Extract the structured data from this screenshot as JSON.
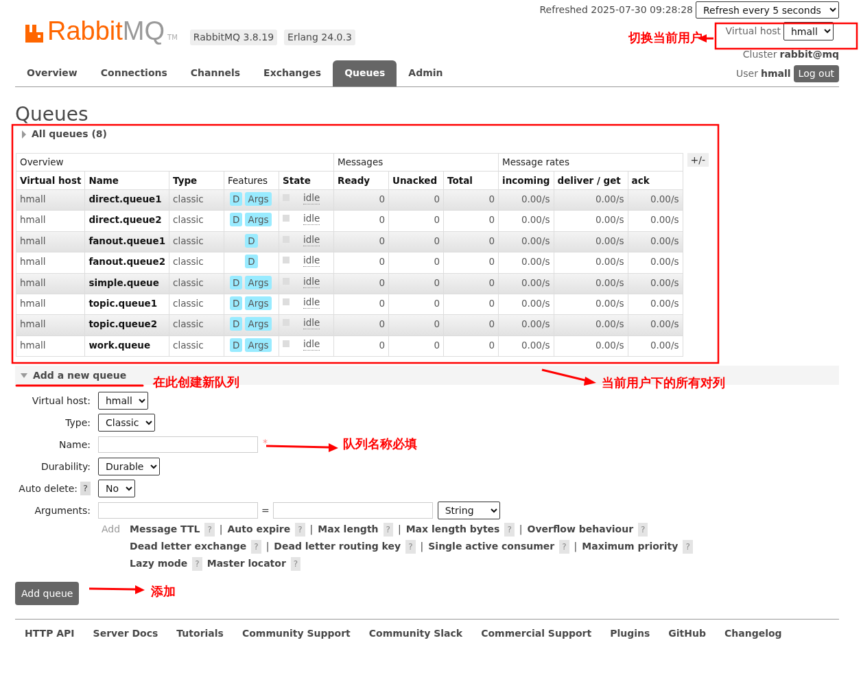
{
  "header": {
    "logo": {
      "primary": "Rabbit",
      "secondary": "MQ",
      "tm": "TM"
    },
    "versions": [
      "RabbitMQ 3.8.19",
      "Erlang 24.0.3"
    ],
    "refreshed": "Refreshed 2025-07-30 09:28:28",
    "refresh_select": "Refresh every 5 seconds",
    "virtual_host_label": "Virtual host",
    "virtual_host_select": "hmall",
    "cluster_label": "Cluster",
    "cluster_value": "rabbit@mq",
    "user_label": "User",
    "user_value": "hmall",
    "logout_button": "Log out"
  },
  "tabs": [
    {
      "label": "Overview",
      "selected": false
    },
    {
      "label": "Connections",
      "selected": false
    },
    {
      "label": "Channels",
      "selected": false
    },
    {
      "label": "Exchanges",
      "selected": false
    },
    {
      "label": "Queues",
      "selected": true
    },
    {
      "label": "Admin",
      "selected": false
    }
  ],
  "page_title": "Queues",
  "all_queues": {
    "title": "All queues (8)",
    "expanded": false,
    "columns_toggle": "+/-",
    "groups": [
      {
        "label": "Overview",
        "columns": [
          {
            "label": "Virtual host",
            "bold": true
          },
          {
            "label": "Name",
            "bold": true
          },
          {
            "label": "Type",
            "bold": true
          },
          {
            "label": "Features",
            "bold": false
          },
          {
            "label": "State",
            "bold": true
          }
        ]
      },
      {
        "label": "Messages",
        "columns": [
          {
            "label": "Ready",
            "bold": true
          },
          {
            "label": "Unacked",
            "bold": true
          },
          {
            "label": "Total",
            "bold": true
          }
        ]
      },
      {
        "label": "Message rates",
        "columns": [
          {
            "label": "incoming",
            "bold": true
          },
          {
            "label": "deliver / get",
            "bold": true
          },
          {
            "label": "ack",
            "bold": true
          }
        ]
      }
    ],
    "rows": [
      {
        "vhost": "hmall",
        "name": "direct.queue1",
        "type": "classic",
        "features": [
          "D",
          "Args"
        ],
        "state": "idle",
        "ready": "0",
        "unacked": "0",
        "total": "0",
        "incoming": "0.00/s",
        "deliver_get": "0.00/s",
        "ack": "0.00/s"
      },
      {
        "vhost": "hmall",
        "name": "direct.queue2",
        "type": "classic",
        "features": [
          "D",
          "Args"
        ],
        "state": "idle",
        "ready": "0",
        "unacked": "0",
        "total": "0",
        "incoming": "0.00/s",
        "deliver_get": "0.00/s",
        "ack": "0.00/s"
      },
      {
        "vhost": "hmall",
        "name": "fanout.queue1",
        "type": "classic",
        "features": [
          "D"
        ],
        "state": "idle",
        "ready": "0",
        "unacked": "0",
        "total": "0",
        "incoming": "0.00/s",
        "deliver_get": "0.00/s",
        "ack": "0.00/s"
      },
      {
        "vhost": "hmall",
        "name": "fanout.queue2",
        "type": "classic",
        "features": [
          "D"
        ],
        "state": "idle",
        "ready": "0",
        "unacked": "0",
        "total": "0",
        "incoming": "0.00/s",
        "deliver_get": "0.00/s",
        "ack": "0.00/s"
      },
      {
        "vhost": "hmall",
        "name": "simple.queue",
        "type": "classic",
        "features": [
          "D",
          "Args"
        ],
        "state": "idle",
        "ready": "0",
        "unacked": "0",
        "total": "0",
        "incoming": "0.00/s",
        "deliver_get": "0.00/s",
        "ack": "0.00/s"
      },
      {
        "vhost": "hmall",
        "name": "topic.queue1",
        "type": "classic",
        "features": [
          "D",
          "Args"
        ],
        "state": "idle",
        "ready": "0",
        "unacked": "0",
        "total": "0",
        "incoming": "0.00/s",
        "deliver_get": "0.00/s",
        "ack": "0.00/s"
      },
      {
        "vhost": "hmall",
        "name": "topic.queue2",
        "type": "classic",
        "features": [
          "D",
          "Args"
        ],
        "state": "idle",
        "ready": "0",
        "unacked": "0",
        "total": "0",
        "incoming": "0.00/s",
        "deliver_get": "0.00/s",
        "ack": "0.00/s"
      },
      {
        "vhost": "hmall",
        "name": "work.queue",
        "type": "classic",
        "features": [
          "D",
          "Args"
        ],
        "state": "idle",
        "ready": "0",
        "unacked": "0",
        "total": "0",
        "incoming": "0.00/s",
        "deliver_get": "0.00/s",
        "ack": "0.00/s"
      }
    ]
  },
  "add_queue": {
    "title": "Add a new queue",
    "expanded": true,
    "fields": [
      {
        "kind": "select",
        "label": "Virtual host:",
        "value": "hmall"
      },
      {
        "kind": "select",
        "label": "Type:",
        "value": "Classic"
      },
      {
        "kind": "text",
        "label": "Name:",
        "required_mark": "*"
      },
      {
        "kind": "select",
        "label": "Durability:",
        "value": "Durable"
      },
      {
        "kind": "select",
        "label": "Auto delete:",
        "value": "No",
        "help": "?"
      },
      {
        "kind": "arguments",
        "label": "Arguments:",
        "equals": "=",
        "type_value": "String"
      }
    ],
    "add_label": "Add",
    "shortcut_lines": [
      {
        "separator": "|",
        "items": [
          {
            "label": "Message TTL",
            "help": "?"
          },
          {
            "label": "Auto expire",
            "help": "?"
          },
          {
            "label": "Max length",
            "help": "?"
          },
          {
            "label": "Max length bytes",
            "help": "?"
          },
          {
            "label": "Overflow behaviour",
            "help": "?"
          }
        ]
      },
      {
        "separator": "|",
        "items": [
          {
            "label": "Dead letter exchange",
            "help": "?"
          },
          {
            "label": "Dead letter routing key",
            "help": "?"
          },
          {
            "label": "Single active consumer",
            "help": "?"
          },
          {
            "label": "Maximum priority",
            "help": "?"
          }
        ]
      },
      {
        "items": [
          {
            "label": "Lazy mode",
            "help": "?"
          },
          {
            "label": "Master locator",
            "help": "?"
          }
        ]
      }
    ],
    "submit_button": "Add queue"
  },
  "footer_links": [
    "HTTP API",
    "Server Docs",
    "Tutorials",
    "Community Support",
    "Community Slack",
    "Commercial Support",
    "Plugins",
    "GitHub",
    "Changelog"
  ],
  "annotations": [
    {
      "kind": "vhost",
      "text": "切换当前用户"
    },
    {
      "kind": "create",
      "text": "在此创建新队列"
    },
    {
      "kind": "list",
      "text": "当前用户下的所有对列"
    },
    {
      "kind": "name",
      "text": "队列名称必填"
    },
    {
      "kind": "add",
      "text": "添加"
    }
  ]
}
